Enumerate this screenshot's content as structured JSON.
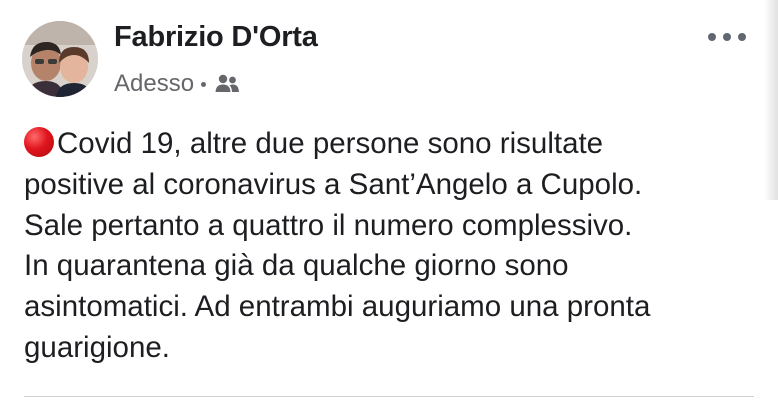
{
  "post": {
    "author_name": "Fabrizio D'Orta",
    "timestamp": "Adesso",
    "separator": "•",
    "audience_icon": "friends-icon",
    "more_icon": "more-horizontal-icon",
    "emoji": "red-circle-emoji",
    "text_lines": [
      "Covid 19, altre due persone sono risultate",
      "positive al coronavirus a Sant’Angelo a Cupolo.",
      "Sale pertanto a quattro il numero complessivo.",
      "In quarantena già da qualche giorno sono",
      "asintomatici. Ad entrambi auguriamo una pronta",
      "guarigione."
    ]
  },
  "colors": {
    "text_primary": "#1c1e21",
    "text_secondary": "#65676b",
    "emoji_red": "#e0151d",
    "divider": "#ced0d4"
  }
}
